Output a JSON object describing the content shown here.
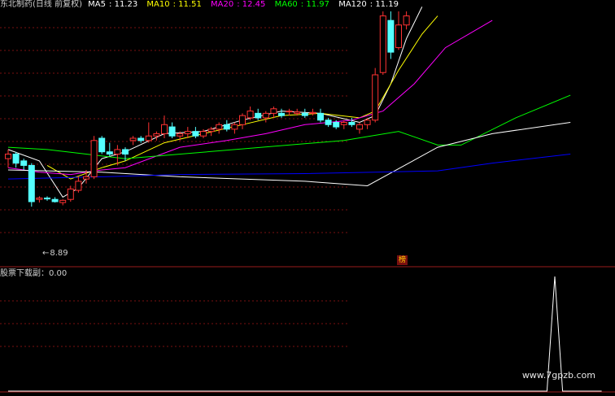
{
  "chart_data": {
    "type": "candlestick",
    "title": "东北制药(日线 前复权)",
    "ma_legend": [
      {
        "name": "MA5",
        "value": "11.23",
        "color": "#ffffff"
      },
      {
        "name": "MA10",
        "value": "11.51",
        "color": "#ffff00"
      },
      {
        "name": "MA20",
        "value": "12.45",
        "color": "#ff00ff"
      },
      {
        "name": "MA60",
        "value": "11.97",
        "color": "#00ff00"
      },
      {
        "name": "MA120",
        "value": "11.19",
        "color": "#ffffff"
      }
    ],
    "ylim": [
      7.6,
      13.2
    ],
    "candles": [
      [
        9.95,
        10.15,
        9.75,
        10.05
      ],
      [
        10.05,
        10.1,
        9.75,
        9.85
      ],
      [
        9.9,
        9.95,
        9.7,
        9.8
      ],
      [
        9.8,
        9.85,
        8.89,
        9.0
      ],
      [
        9.05,
        9.12,
        8.98,
        9.08
      ],
      [
        9.08,
        9.12,
        9.02,
        9.06
      ],
      [
        9.05,
        9.1,
        8.98,
        9.0
      ],
      [
        8.98,
        9.05,
        8.92,
        9.03
      ],
      [
        9.05,
        9.35,
        9.0,
        9.28
      ],
      [
        9.25,
        9.55,
        9.2,
        9.45
      ],
      [
        9.5,
        9.7,
        9.4,
        9.55
      ],
      [
        9.55,
        10.45,
        9.5,
        10.35
      ],
      [
        10.4,
        10.45,
        10.05,
        10.1
      ],
      [
        10.1,
        10.3,
        10.0,
        10.05
      ],
      [
        10.05,
        10.25,
        9.8,
        10.15
      ],
      [
        10.15,
        10.2,
        9.9,
        10.05
      ],
      [
        10.35,
        10.45,
        10.25,
        10.4
      ],
      [
        10.4,
        10.45,
        10.3,
        10.35
      ],
      [
        10.35,
        10.75,
        10.3,
        10.45
      ],
      [
        10.45,
        10.55,
        10.35,
        10.5
      ],
      [
        10.5,
        10.9,
        10.4,
        10.7
      ],
      [
        10.65,
        10.75,
        10.4,
        10.45
      ],
      [
        10.45,
        10.55,
        10.35,
        10.5
      ],
      [
        10.5,
        10.65,
        10.4,
        10.55
      ],
      [
        10.55,
        10.65,
        10.4,
        10.45
      ],
      [
        10.45,
        10.6,
        10.4,
        10.55
      ],
      [
        10.55,
        10.65,
        10.45,
        10.6
      ],
      [
        10.6,
        10.75,
        10.5,
        10.7
      ],
      [
        10.7,
        10.8,
        10.55,
        10.6
      ],
      [
        10.6,
        10.75,
        10.5,
        10.7
      ],
      [
        10.7,
        10.95,
        10.6,
        10.9
      ],
      [
        10.85,
        11.1,
        10.8,
        11.0
      ],
      [
        10.95,
        11.05,
        10.8,
        10.85
      ],
      [
        10.85,
        11.0,
        10.75,
        10.95
      ],
      [
        10.95,
        11.1,
        10.85,
        11.05
      ],
      [
        10.95,
        11.05,
        10.85,
        10.9
      ],
      [
        11.0,
        11.05,
        10.9,
        11.0
      ],
      [
        10.95,
        11.05,
        10.9,
        10.98
      ],
      [
        10.95,
        11.05,
        10.85,
        10.9
      ],
      [
        10.95,
        11.05,
        10.9,
        10.97
      ],
      [
        10.95,
        11.05,
        10.75,
        10.8
      ],
      [
        10.8,
        10.85,
        10.65,
        10.7
      ],
      [
        10.75,
        10.8,
        10.6,
        10.65
      ],
      [
        10.7,
        10.8,
        10.6,
        10.75
      ],
      [
        10.75,
        10.85,
        10.65,
        10.7
      ],
      [
        10.6,
        10.75,
        10.5,
        10.7
      ],
      [
        10.7,
        10.85,
        10.6,
        10.8
      ],
      [
        10.8,
        11.95,
        10.75,
        11.8
      ],
      [
        11.85,
        13.2,
        11.8,
        13.1
      ],
      [
        13.0,
        13.2,
        12.15,
        12.3
      ],
      [
        12.4,
        13.2,
        12.35,
        12.9
      ],
      [
        12.9,
        13.2,
        12.8,
        13.1
      ]
    ],
    "ma_lines": {
      "MA5": [
        [
          0,
          10.15
        ],
        [
          4,
          9.9
        ],
        [
          7,
          9.1
        ],
        [
          9,
          9.3
        ],
        [
          12,
          9.95
        ],
        [
          15,
          10.1
        ],
        [
          20,
          10.5
        ],
        [
          25,
          10.55
        ],
        [
          30,
          10.8
        ],
        [
          35,
          11.0
        ],
        [
          40,
          10.95
        ],
        [
          45,
          10.75
        ],
        [
          47,
          10.9
        ],
        [
          49,
          11.6
        ],
        [
          51,
          12.6
        ],
        [
          53,
          13.3
        ]
      ],
      "MA10": [
        [
          5,
          9.8
        ],
        [
          8,
          9.5
        ],
        [
          12,
          9.75
        ],
        [
          15,
          9.9
        ],
        [
          20,
          10.3
        ],
        [
          25,
          10.5
        ],
        [
          30,
          10.7
        ],
        [
          35,
          10.9
        ],
        [
          40,
          10.95
        ],
        [
          45,
          10.85
        ],
        [
          47,
          11.0
        ],
        [
          50,
          11.9
        ],
        [
          53,
          12.7
        ],
        [
          55,
          13.1
        ]
      ],
      "MA20": [
        [
          0,
          9.75
        ],
        [
          4,
          9.65
        ],
        [
          8,
          9.6
        ],
        [
          12,
          9.7
        ],
        [
          15,
          9.75
        ],
        [
          22,
          10.2
        ],
        [
          28,
          10.35
        ],
        [
          33,
          10.5
        ],
        [
          38,
          10.7
        ],
        [
          44,
          10.8
        ],
        [
          48,
          11.0
        ],
        [
          52,
          11.6
        ],
        [
          56,
          12.4
        ],
        [
          62,
          13.0
        ]
      ],
      "MA60": [
        [
          0,
          10.2
        ],
        [
          5,
          10.15
        ],
        [
          10,
          10.05
        ],
        [
          15,
          9.95
        ],
        [
          43,
          10.35
        ],
        [
          50,
          10.55
        ],
        [
          55,
          10.25
        ],
        [
          58,
          10.25
        ],
        [
          65,
          10.85
        ],
        [
          72,
          11.35
        ]
      ],
      "MA120": [
        [
          0,
          9.7
        ],
        [
          12,
          9.65
        ],
        [
          22,
          9.55
        ],
        [
          38,
          9.45
        ],
        [
          46,
          9.35
        ],
        [
          55,
          10.2
        ],
        [
          62,
          10.5
        ],
        [
          72,
          10.75
        ]
      ],
      "BLUE": [
        [
          0,
          9.5
        ],
        [
          12,
          9.55
        ],
        [
          22,
          9.6
        ],
        [
          38,
          9.62
        ],
        [
          55,
          9.68
        ],
        [
          62,
          9.85
        ],
        [
          72,
          10.05
        ]
      ]
    },
    "low_marker": "8.89",
    "indicator": {
      "label": "股票下载副：0.00",
      "ylim": [
        0,
        1
      ],
      "values": [
        [
          0,
          0
        ],
        [
          69,
          0
        ],
        [
          70,
          1
        ],
        [
          71,
          0
        ],
        [
          76,
          0
        ]
      ]
    },
    "badge": "榜",
    "watermark": "www.7gpzb.com"
  }
}
